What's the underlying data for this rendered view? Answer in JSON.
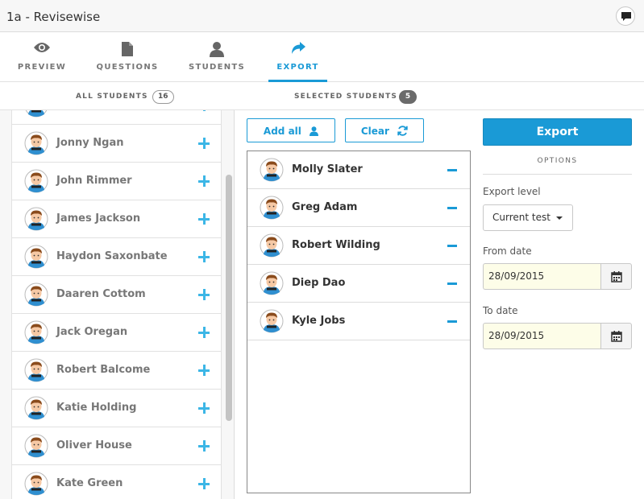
{
  "window": {
    "title": "1a - Revisewise"
  },
  "nav": {
    "tabs": [
      {
        "label": "PREVIEW",
        "icon": "eye-icon"
      },
      {
        "label": "QUESTIONS",
        "icon": "document-icon"
      },
      {
        "label": "STUDENTS",
        "icon": "person-icon"
      },
      {
        "label": "EXPORT",
        "icon": "share-arrow-icon",
        "active": true
      }
    ]
  },
  "counts": {
    "all_label": "ALL STUDENTS",
    "all_count": "16",
    "selected_label": "SELECTED STUDENTS",
    "selected_count": "5"
  },
  "all_students": [
    "Jonny Ngan",
    "John Rimmer",
    "James Jackson",
    "Haydon Saxonbate",
    "Daaren Cottom",
    "Jack Oregan",
    "Robert Balcome",
    "Katie Holding",
    "Oliver House",
    "Kate Green"
  ],
  "actions": {
    "add_all_label": "Add all",
    "clear_label": "Clear",
    "export_label": "Export"
  },
  "selected_students": [
    "Molly Slater",
    "Greg Adam",
    "Robert Wilding",
    "Diep Dao",
    "Kyle Jobs"
  ],
  "options": {
    "heading": "OPTIONS",
    "export_level_label": "Export level",
    "export_level_value": "Current test",
    "from_date_label": "From date",
    "from_date_value": "28/09/2015",
    "to_date_label": "To date",
    "to_date_value": "28/09/2015"
  },
  "colors": {
    "accent": "#1a9ad6",
    "plus": "#3cb6e6",
    "date_bg": "#fdfde8"
  }
}
